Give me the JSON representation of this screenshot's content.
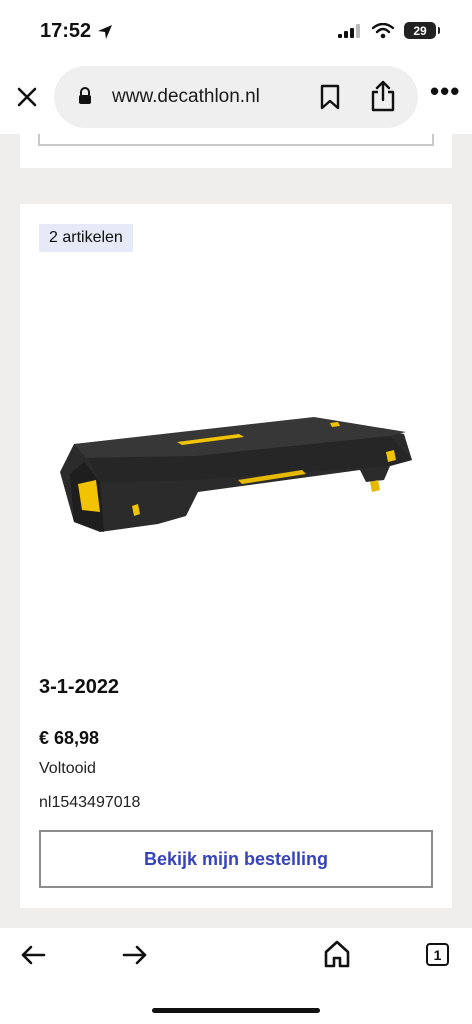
{
  "status_bar": {
    "time": "17:52",
    "battery": "29"
  },
  "browser": {
    "url": "www.decathlon.nl",
    "tab_count": "1"
  },
  "order": {
    "items_badge": "2 artikelen",
    "date": "3-1-2022",
    "price": "€ 68,98",
    "status": "Voltooid",
    "order_number": "nl1543497018",
    "view_button_label": "Bekijk mijn bestelling"
  },
  "icons": {
    "location": "location-arrow-icon",
    "signal": "cellular-signal-icon",
    "wifi": "wifi-icon",
    "battery": "battery-icon",
    "close": "close-icon",
    "lock": "lock-icon",
    "bookmark": "bookmark-icon",
    "share": "share-icon",
    "more": "more-icon",
    "back": "back-arrow-icon",
    "forward": "forward-arrow-icon",
    "home": "home-icon",
    "tabs": "tabs-icon"
  },
  "colors": {
    "accent": "#3643ba",
    "badge_bg": "#e6e9f6",
    "page_bg": "#efeeec",
    "product_yellow": "#f2c300"
  }
}
